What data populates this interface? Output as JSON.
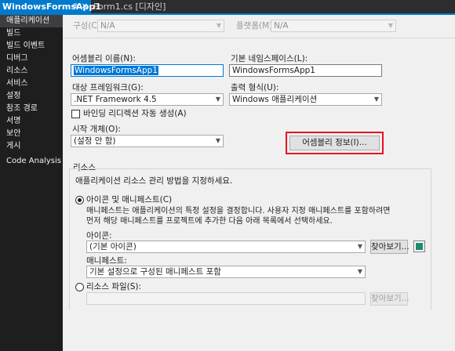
{
  "tabs": {
    "active_label": "WindowsFormsApp1",
    "pin_glyph": "⊕",
    "close_glyph": "✕",
    "inactive_label": "Form1.cs [디자인]"
  },
  "sidebar": {
    "items": [
      {
        "label": "애플리케이션"
      },
      {
        "label": "빌드"
      },
      {
        "label": "빌드 이벤트"
      },
      {
        "label": "디버그"
      },
      {
        "label": "리소스"
      },
      {
        "label": "서비스"
      },
      {
        "label": "설정"
      },
      {
        "label": "참조 경로"
      },
      {
        "label": "서명"
      },
      {
        "label": "보안"
      },
      {
        "label": "게시"
      },
      {
        "label": "Code Analysis"
      }
    ]
  },
  "config": {
    "config_label": "구성(C):",
    "config_value": "N/A",
    "platform_label": "플랫폼(M):",
    "platform_value": "N/A"
  },
  "app": {
    "assembly_name_label": "어셈블리 이름(N):",
    "assembly_name_value": "WindowsFormsApp1",
    "default_ns_label": "기본 네임스페이스(L):",
    "default_ns_value": "WindowsFormsApp1",
    "target_fw_label": "대상 프레임워크(G):",
    "target_fw_value": ".NET Framework 4.5",
    "output_type_label": "출력 형식(U):",
    "output_type_value": "Windows 애플리케이션",
    "binding_redirect_label": "바인딩 리디렉션 자동 생성(A)",
    "startup_object_label": "시작 개체(O):",
    "startup_object_value": "(설정 안 함)",
    "assembly_info_button": "어셈블리 정보(I)..."
  },
  "resources": {
    "group_title": "리소스",
    "description": "애플리케이션 리소스 관리 방법을 지정하세요.",
    "icon_manifest_radio": "아이콘 및 매니페스트(C)",
    "manifest_desc_line1": "매니페스트는 애플리케이션의 특정 설정을 결정합니다. 사용자 지정 매니페스트를 포함하려면",
    "manifest_desc_line2": "먼저 해당 매니페스트를 프로젝트에 추가한 다음 아래 목록에서 선택하세요.",
    "icon_label": "아이콘:",
    "icon_value": "(기본 아이콘)",
    "browse_button": "찾아보기...",
    "manifest_label": "매니페스트:",
    "manifest_value": "기본 설정으로 구성된 매니페스트 포함",
    "resource_file_radio": "리소스 파일(S):",
    "resource_browse_button": "찾아보기..."
  },
  "colors": {
    "accent": "#007acc",
    "sidebar_bg": "#1e1e1e",
    "highlight_border": "#e81123",
    "selection": "#0078d7"
  }
}
